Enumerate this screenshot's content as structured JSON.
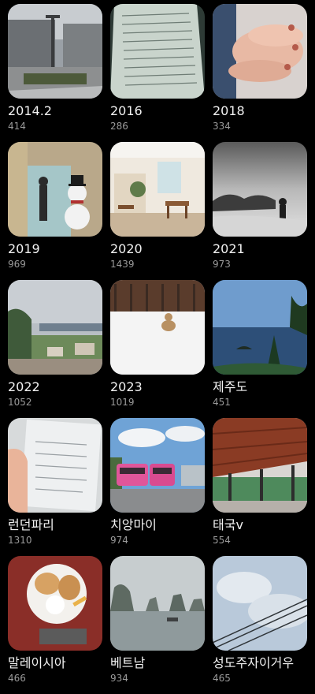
{
  "albums": [
    {
      "title": "2014.2",
      "count": "414",
      "thumb": "building-photo"
    },
    {
      "title": "2016",
      "count": "286",
      "thumb": "notebook-photo"
    },
    {
      "title": "2018",
      "count": "334",
      "thumb": "hands-photo"
    },
    {
      "title": "2019",
      "count": "969",
      "thumb": "snowman-photo"
    },
    {
      "title": "2020",
      "count": "1439",
      "thumb": "cafe-photo"
    },
    {
      "title": "2021",
      "count": "973",
      "thumb": "mountain-mist-photo"
    },
    {
      "title": "2022",
      "count": "1052",
      "thumb": "coast-photo"
    },
    {
      "title": "2023",
      "count": "1019",
      "thumb": "snow-dog-photo"
    },
    {
      "title": "제주도",
      "count": "451",
      "thumb": "sea-rock-photo"
    },
    {
      "title": "런던파리",
      "count": "1310",
      "thumb": "document-photo"
    },
    {
      "title": "치앙마이",
      "count": "974",
      "thumb": "pink-bus-photo"
    },
    {
      "title": "태국v",
      "count": "554",
      "thumb": "station-photo"
    },
    {
      "title": "말레이시아",
      "count": "466",
      "thumb": "food-plate-photo"
    },
    {
      "title": "베트남",
      "count": "934",
      "thumb": "bay-karst-photo"
    },
    {
      "title": "성도주자이거우",
      "count": "465",
      "thumb": "powerline-sky-photo"
    }
  ]
}
